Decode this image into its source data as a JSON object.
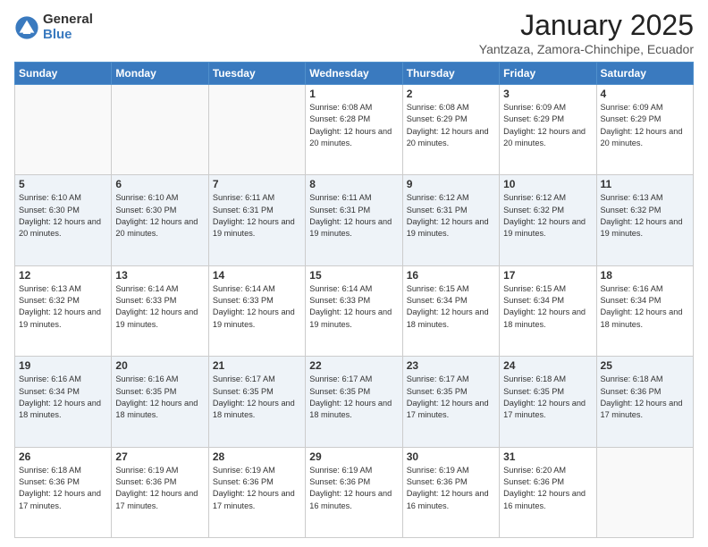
{
  "logo": {
    "general": "General",
    "blue": "Blue"
  },
  "header": {
    "month": "January 2025",
    "location": "Yantzaza, Zamora-Chinchipe, Ecuador"
  },
  "days_of_week": [
    "Sunday",
    "Monday",
    "Tuesday",
    "Wednesday",
    "Thursday",
    "Friday",
    "Saturday"
  ],
  "weeks": [
    [
      {
        "day": "",
        "info": ""
      },
      {
        "day": "",
        "info": ""
      },
      {
        "day": "",
        "info": ""
      },
      {
        "day": "1",
        "info": "Sunrise: 6:08 AM\nSunset: 6:28 PM\nDaylight: 12 hours and 20 minutes."
      },
      {
        "day": "2",
        "info": "Sunrise: 6:08 AM\nSunset: 6:29 PM\nDaylight: 12 hours and 20 minutes."
      },
      {
        "day": "3",
        "info": "Sunrise: 6:09 AM\nSunset: 6:29 PM\nDaylight: 12 hours and 20 minutes."
      },
      {
        "day": "4",
        "info": "Sunrise: 6:09 AM\nSunset: 6:29 PM\nDaylight: 12 hours and 20 minutes."
      }
    ],
    [
      {
        "day": "5",
        "info": "Sunrise: 6:10 AM\nSunset: 6:30 PM\nDaylight: 12 hours and 20 minutes."
      },
      {
        "day": "6",
        "info": "Sunrise: 6:10 AM\nSunset: 6:30 PM\nDaylight: 12 hours and 20 minutes."
      },
      {
        "day": "7",
        "info": "Sunrise: 6:11 AM\nSunset: 6:31 PM\nDaylight: 12 hours and 19 minutes."
      },
      {
        "day": "8",
        "info": "Sunrise: 6:11 AM\nSunset: 6:31 PM\nDaylight: 12 hours and 19 minutes."
      },
      {
        "day": "9",
        "info": "Sunrise: 6:12 AM\nSunset: 6:31 PM\nDaylight: 12 hours and 19 minutes."
      },
      {
        "day": "10",
        "info": "Sunrise: 6:12 AM\nSunset: 6:32 PM\nDaylight: 12 hours and 19 minutes."
      },
      {
        "day": "11",
        "info": "Sunrise: 6:13 AM\nSunset: 6:32 PM\nDaylight: 12 hours and 19 minutes."
      }
    ],
    [
      {
        "day": "12",
        "info": "Sunrise: 6:13 AM\nSunset: 6:32 PM\nDaylight: 12 hours and 19 minutes."
      },
      {
        "day": "13",
        "info": "Sunrise: 6:14 AM\nSunset: 6:33 PM\nDaylight: 12 hours and 19 minutes."
      },
      {
        "day": "14",
        "info": "Sunrise: 6:14 AM\nSunset: 6:33 PM\nDaylight: 12 hours and 19 minutes."
      },
      {
        "day": "15",
        "info": "Sunrise: 6:14 AM\nSunset: 6:33 PM\nDaylight: 12 hours and 19 minutes."
      },
      {
        "day": "16",
        "info": "Sunrise: 6:15 AM\nSunset: 6:34 PM\nDaylight: 12 hours and 18 minutes."
      },
      {
        "day": "17",
        "info": "Sunrise: 6:15 AM\nSunset: 6:34 PM\nDaylight: 12 hours and 18 minutes."
      },
      {
        "day": "18",
        "info": "Sunrise: 6:16 AM\nSunset: 6:34 PM\nDaylight: 12 hours and 18 minutes."
      }
    ],
    [
      {
        "day": "19",
        "info": "Sunrise: 6:16 AM\nSunset: 6:34 PM\nDaylight: 12 hours and 18 minutes."
      },
      {
        "day": "20",
        "info": "Sunrise: 6:16 AM\nSunset: 6:35 PM\nDaylight: 12 hours and 18 minutes."
      },
      {
        "day": "21",
        "info": "Sunrise: 6:17 AM\nSunset: 6:35 PM\nDaylight: 12 hours and 18 minutes."
      },
      {
        "day": "22",
        "info": "Sunrise: 6:17 AM\nSunset: 6:35 PM\nDaylight: 12 hours and 18 minutes."
      },
      {
        "day": "23",
        "info": "Sunrise: 6:17 AM\nSunset: 6:35 PM\nDaylight: 12 hours and 17 minutes."
      },
      {
        "day": "24",
        "info": "Sunrise: 6:18 AM\nSunset: 6:35 PM\nDaylight: 12 hours and 17 minutes."
      },
      {
        "day": "25",
        "info": "Sunrise: 6:18 AM\nSunset: 6:36 PM\nDaylight: 12 hours and 17 minutes."
      }
    ],
    [
      {
        "day": "26",
        "info": "Sunrise: 6:18 AM\nSunset: 6:36 PM\nDaylight: 12 hours and 17 minutes."
      },
      {
        "day": "27",
        "info": "Sunrise: 6:19 AM\nSunset: 6:36 PM\nDaylight: 12 hours and 17 minutes."
      },
      {
        "day": "28",
        "info": "Sunrise: 6:19 AM\nSunset: 6:36 PM\nDaylight: 12 hours and 17 minutes."
      },
      {
        "day": "29",
        "info": "Sunrise: 6:19 AM\nSunset: 6:36 PM\nDaylight: 12 hours and 16 minutes."
      },
      {
        "day": "30",
        "info": "Sunrise: 6:19 AM\nSunset: 6:36 PM\nDaylight: 12 hours and 16 minutes."
      },
      {
        "day": "31",
        "info": "Sunrise: 6:20 AM\nSunset: 6:36 PM\nDaylight: 12 hours and 16 minutes."
      },
      {
        "day": "",
        "info": ""
      }
    ]
  ]
}
